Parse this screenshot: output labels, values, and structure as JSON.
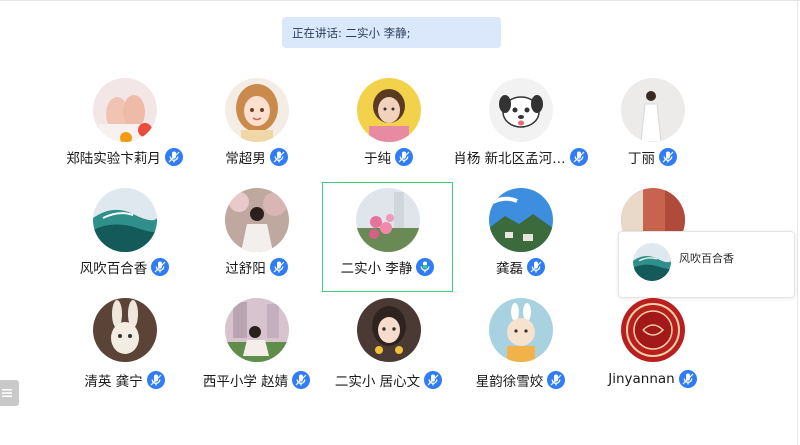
{
  "speaking": {
    "text": "正在讲话: 二实小 李静;"
  },
  "participants": [
    {
      "name": "郑陆实验卞莉月",
      "avatar_icon": "baby-feet-photo-avatar-icon",
      "mic_icon": "mic-icon"
    },
    {
      "name": "常超男",
      "avatar_icon": "cartoon-girl-avatar-icon",
      "mic_icon": "mic-icon"
    },
    {
      "name": "于纯",
      "avatar_icon": "woman-portrait-avatar-icon",
      "mic_icon": "mic-icon"
    },
    {
      "name": "肖杨 新北区孟河…",
      "avatar_icon": "cartoon-dog-avatar-icon",
      "mic_icon": "mic-icon"
    },
    {
      "name": "丁丽",
      "avatar_icon": "woman-white-dress-avatar-icon",
      "mic_icon": "mic-icon"
    },
    {
      "name": "风吹百合香",
      "avatar_icon": "ocean-wave-avatar-icon",
      "mic_icon": "mic-icon"
    },
    {
      "name": "过舒阳",
      "avatar_icon": "girl-blossoms-avatar-icon",
      "mic_icon": "mic-icon"
    },
    {
      "name": "二实小 李静",
      "avatar_icon": "pink-flowers-avatar-icon",
      "mic_icon": "mic-active-icon",
      "active": true
    },
    {
      "name": "龚磊",
      "avatar_icon": "mountain-village-avatar-icon",
      "mic_icon": "mic-icon"
    },
    {
      "name": "",
      "avatar_icon": "room-photo-avatar-icon",
      "mic_icon": ""
    },
    {
      "name": "清英 龚宁",
      "avatar_icon": "bunny-toy-avatar-icon",
      "mic_icon": "mic-icon"
    },
    {
      "name": "西平小学 赵婧",
      "avatar_icon": "woman-outdoor-avatar-icon",
      "mic_icon": "mic-icon"
    },
    {
      "name": "二实小 居心文",
      "avatar_icon": "girl-selfie-avatar-icon",
      "mic_icon": "mic-icon"
    },
    {
      "name": "星韵徐雪姣",
      "avatar_icon": "cartoon-kid-avatar-icon",
      "mic_icon": "mic-icon"
    },
    {
      "name": "Jinyannan",
      "avatar_icon": "red-seal-avatar-icon",
      "mic_icon": "mic-icon"
    }
  ],
  "hover_card": {
    "name": "风吹百合香",
    "avatar_icon": "ocean-wave-avatar-icon"
  },
  "colors": {
    "accent": "#2f7cf6",
    "active_border": "#3ccf7a",
    "banner_bg": "#dbe8fb"
  }
}
